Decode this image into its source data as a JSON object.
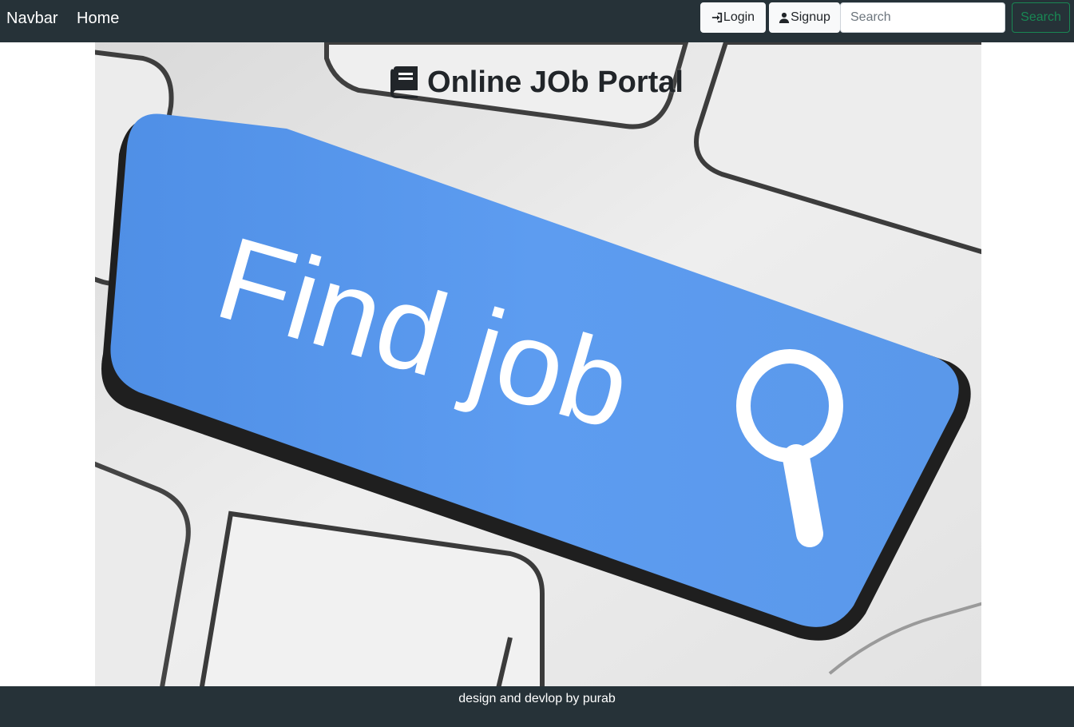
{
  "navbar": {
    "brand": "Navbar",
    "home_label": "Home",
    "login_label": "Login",
    "signup_label": "Signup",
    "search_placeholder": "Search",
    "search_button_label": "Search",
    "login_icon": "sign-in-icon",
    "signup_icon": "user-icon"
  },
  "hero": {
    "title": "Online JOb Portal",
    "title_icon": "book-icon",
    "image_text": "Find job",
    "image_icon": "magnifier-icon"
  },
  "footer": {
    "text": "design and devlop by purab"
  },
  "colors": {
    "navbar_bg": "#263238",
    "key_blue": "#5b98ea",
    "search_green": "#198754"
  }
}
